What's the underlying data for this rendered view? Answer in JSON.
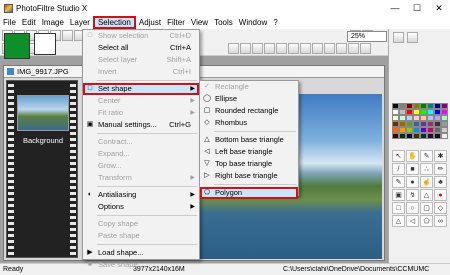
{
  "window": {
    "title": "PhotoFiltre Studio X"
  },
  "menubar": [
    "File",
    "Edit",
    "Image",
    "Layer",
    "Selection",
    "Adjust",
    "Filter",
    "View",
    "Tools",
    "Window",
    "?"
  ],
  "toolbar": {
    "zoom": "25%"
  },
  "document": {
    "title": "IMG_9917.JPG",
    "thumbnail_label": "Background"
  },
  "selection_menu": [
    {
      "label": "Show selection",
      "shortcut": "Ctrl+D",
      "disabled": true
    },
    {
      "label": "Select all",
      "shortcut": "Ctrl+A",
      "disabled": false
    },
    {
      "label": "Select layer",
      "shortcut": "Shift+A",
      "disabled": true
    },
    {
      "label": "Invert",
      "shortcut": "Ctrl+I",
      "disabled": true
    },
    {
      "label": "Set shape",
      "shortcut": "",
      "disabled": false,
      "submenu": true,
      "highlight": true
    },
    {
      "label": "Center",
      "shortcut": "",
      "disabled": true,
      "submenu": true
    },
    {
      "label": "Fit ratio",
      "shortcut": "",
      "disabled": true,
      "submenu": true
    },
    {
      "label": "Manual settings...",
      "shortcut": "Ctrl+G",
      "disabled": false
    },
    {
      "label": "Contract...",
      "shortcut": "",
      "disabled": true
    },
    {
      "label": "Expand...",
      "shortcut": "",
      "disabled": true
    },
    {
      "label": "Grow...",
      "shortcut": "",
      "disabled": true
    },
    {
      "label": "Transform",
      "shortcut": "",
      "disabled": true,
      "submenu": true
    },
    {
      "label": "Antialiasing",
      "shortcut": "",
      "disabled": false,
      "submenu": true
    },
    {
      "label": "Options",
      "shortcut": "",
      "disabled": false,
      "submenu": true
    },
    {
      "label": "Copy shape",
      "shortcut": "",
      "disabled": true
    },
    {
      "label": "Paste shape",
      "shortcut": "",
      "disabled": true
    },
    {
      "label": "Load shape...",
      "shortcut": "",
      "disabled": false
    },
    {
      "label": "Save shape...",
      "shortcut": "",
      "disabled": true
    }
  ],
  "shape_submenu": [
    {
      "label": "Rectangle",
      "disabled": true
    },
    {
      "label": "Ellipse",
      "disabled": false
    },
    {
      "label": "Rounded rectangle",
      "disabled": false
    },
    {
      "label": "Rhombus",
      "disabled": false
    },
    {
      "label": "Bottom base triangle",
      "disabled": false
    },
    {
      "label": "Left base triangle",
      "disabled": false
    },
    {
      "label": "Top base triangle",
      "disabled": false
    },
    {
      "label": "Right base triangle",
      "disabled": false
    },
    {
      "label": "Polygon",
      "disabled": false,
      "highlight": true
    }
  ],
  "status": {
    "ready": "Ready",
    "dimensions": "3977x2140x16M",
    "path": "C:\\Users\\clahi\\OneDrive\\Documents\\CCMUMC"
  },
  "colors": {
    "foreground": "#0f8f2a",
    "background": "#ffffff",
    "highlight_border": "#d0101a"
  }
}
